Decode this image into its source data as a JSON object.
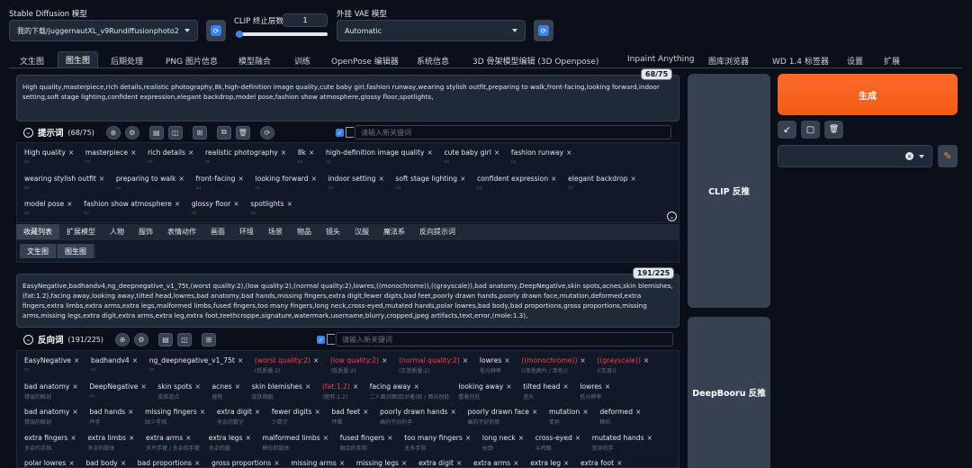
{
  "header": {
    "model_label": "Stable Diffusion 模型",
    "model_value": "我的下载/juggernautXL_v9Rundiffusionphoto2",
    "clip_label": "CLIP 终止层数",
    "clip_value": "1",
    "clip_fraction": 0.0,
    "vae_label": "外挂 VAE 模型",
    "vae_value": "Automatic"
  },
  "tabs": [
    {
      "label": "文生图",
      "active": false
    },
    {
      "label": "图生图",
      "active": true
    },
    {
      "label": "后期处理",
      "active": false
    },
    {
      "label": "PNG 图片信息",
      "active": false
    },
    {
      "label": "模型融合",
      "active": false
    },
    {
      "label": "训练",
      "active": false
    },
    {
      "label": "OpenPose 编辑器",
      "active": false
    },
    {
      "label": "系统信息",
      "active": false
    },
    {
      "label": "3D 骨架模型编辑 (3D Openpose)",
      "active": false
    },
    {
      "label": "Inpaint Anything",
      "active": false
    },
    {
      "label": "图库浏览器",
      "active": false
    },
    {
      "label": "WD 1.4 标签器",
      "active": false
    },
    {
      "label": "设置",
      "active": false
    },
    {
      "label": "扩展",
      "active": false
    }
  ],
  "positive": {
    "counter": "68/75",
    "text": "High quality,masterpiece,rich details,realistic photography,8k,high-definition image quality,cute baby girl,fashion runway,wearing stylish outfit,preparing to walk,front-facing,looking forward,indoor setting,soft stage lighting,confident expression,elegant backdrop,model pose,fashion show atmosphere,glossy floor,spotlights,",
    "title": "提示词",
    "count": "(68/75)",
    "keyword_placeholder": "请输入新关键词",
    "tags": [
      "High quality",
      "masterpiece",
      "rich details",
      "realistic photography",
      "8k",
      "high-definition image quality",
      "cute baby girl",
      "fashion runway",
      "wearing stylish outfit",
      "preparing to walk",
      "front-facing",
      "looking forward",
      "indoor setting",
      "soft stage lighting",
      "confident expression",
      "elegant backdrop",
      "model pose",
      "fashion show atmosphere",
      "glossy floor",
      "spotlights"
    ]
  },
  "category_bar": [
    "收藏列表",
    "扩展模型",
    "人物",
    "服饰",
    "表情动作",
    "画面",
    "环境",
    "场景",
    "物品",
    "镜头",
    "汉服",
    "魔法系",
    "反向提示词"
  ],
  "sub_bar": [
    "文生图",
    "图生图"
  ],
  "negative": {
    "counter": "191/225",
    "text": "EasyNegative,badhandv4,ng_deepnegative_v1_75t,(worst quality:2),(low quality:2),(normal quality:2),lowres,((monochrome)),((grayscale)),bad anatomy,DeepNegative,skin spots,acnes,skin blemishes,(fat:1.2),facing away,looking away,tilted head,lowres,bad anatomy,bad hands,missing fingers,extra digit,fewer digits,bad feet,poorly drawn hands,poorly drawn face,mutation,deformed,extra fingers,extra limbs,extra arms,extra legs,malformed limbs,fused fingers,too many fingers,long neck,cross-eyed,mutated hands,polar lowres,bad body,bad proportions,gross proportions,missing arms,missing legs,extra digit,extra arms,extra leg,extra foot,teethcroppe,signature,watermark,username,blurry,cropped,jpeg artifacts,text,error,(mole:1.3),",
    "title": "反向词",
    "count": "(191/225)",
    "keyword_placeholder": "请输入新关键词",
    "tags": [
      {
        "t": "EasyNegative",
        "s": ""
      },
      {
        "t": "badhandv4",
        "s": ""
      },
      {
        "t": "ng_deepnegative_v1_75t",
        "s": ""
      },
      {
        "t": "worst quality:2",
        "s": "(低质量:2)",
        "r": true
      },
      {
        "t": "low quality:2",
        "s": "(低质量:2)",
        "r": true
      },
      {
        "t": "normal quality:2",
        "s": "(正常质量:2)",
        "r": true
      },
      {
        "t": "lowres",
        "s": "低分辨率"
      },
      {
        "t": "(monochrome)",
        "s": "((单色图片 / 单色))",
        "r": true
      },
      {
        "t": "(grayscale)",
        "s": "((灰度))",
        "r": true
      },
      {
        "t": "bad anatomy",
        "s": "错误的解剖"
      },
      {
        "t": "DeepNegative",
        "s": ""
      },
      {
        "t": "skin spots",
        "s": "皮肤斑点"
      },
      {
        "t": "acnes",
        "s": "痤疮"
      },
      {
        "t": "skin blemishes",
        "s": "皮肤瑕疵"
      },
      {
        "t": "fat:1.2",
        "s": "(肥胖:1.2)",
        "r": true
      },
      {
        "t": "facing away",
        "s": "二人面对面(脸对着)脸 / 面向别处"
      },
      {
        "t": "looking away",
        "s": "看着别处"
      },
      {
        "t": "tilted head",
        "s": "歪头"
      },
      {
        "t": "lowres",
        "s": "低分辨率"
      },
      {
        "t": "bad anatomy",
        "s": "错误的解剖"
      },
      {
        "t": "bad hands",
        "s": "坏手"
      },
      {
        "t": "missing fingers",
        "s": "缺少手指"
      },
      {
        "t": "extra digit",
        "s": "多余的数字"
      },
      {
        "t": "fewer digits",
        "s": "少数字"
      },
      {
        "t": "bad feet",
        "s": "坏脚"
      },
      {
        "t": "poorly drawn hands",
        "s": "画的不好的手"
      },
      {
        "t": "poorly drawn face",
        "s": "画的不好的脸"
      },
      {
        "t": "mutation",
        "s": "变异"
      },
      {
        "t": "deformed",
        "s": "畸形"
      },
      {
        "t": "extra fingers",
        "s": "多余的手指"
      },
      {
        "t": "extra limbs",
        "s": "多余的肢体"
      },
      {
        "t": "extra arms",
        "s": "多只手臂 / 多余的手臂"
      },
      {
        "t": "extra legs",
        "s": "多余的腿"
      },
      {
        "t": "malformed limbs",
        "s": "畸形的肢体"
      },
      {
        "t": "fused fingers",
        "s": "融合的手指"
      },
      {
        "t": "too many fingers",
        "s": "太多手指"
      },
      {
        "t": "long neck",
        "s": "长颈"
      },
      {
        "t": "cross-eyed",
        "s": "斗鸡眼"
      },
      {
        "t": "mutated hands",
        "s": "变异的手"
      },
      {
        "t": "polar lowres",
        "s": ""
      },
      {
        "t": "bad body",
        "s": ""
      },
      {
        "t": "bad proportions",
        "s": ""
      },
      {
        "t": "gross proportions",
        "s": ""
      },
      {
        "t": "missing arms",
        "s": ""
      },
      {
        "t": "missing legs",
        "s": ""
      },
      {
        "t": "extra digit",
        "s": ""
      },
      {
        "t": "extra arms",
        "s": ""
      },
      {
        "t": "extra leg",
        "s": ""
      },
      {
        "t": "extra foot",
        "s": ""
      }
    ]
  },
  "right": {
    "clip_btn": "CLIP 反推",
    "deepbooru_btn": "DeepBooru 反推",
    "generate": "生成"
  },
  "colors": {
    "accent": "#f25a12",
    "blue": "#3b82f6",
    "red": "#ef4444"
  }
}
